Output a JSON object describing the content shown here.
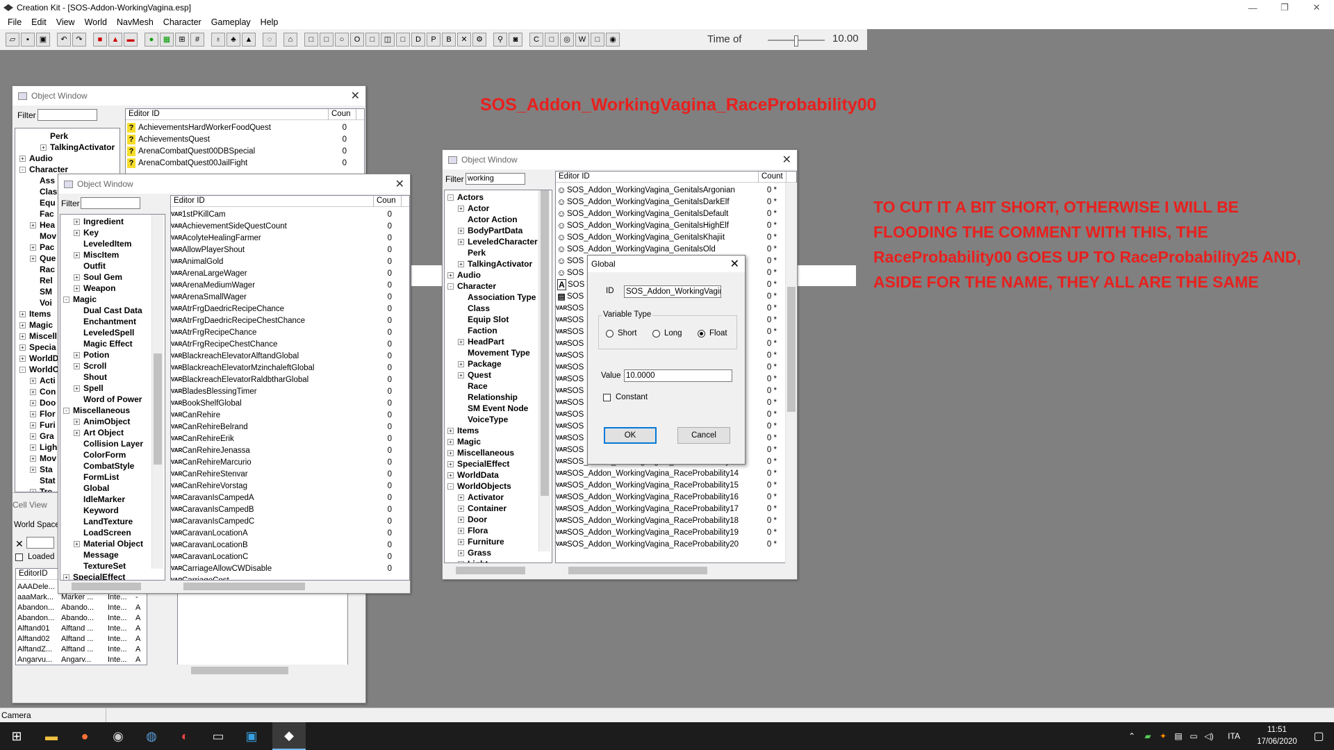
{
  "app": {
    "title": "Creation Kit - [SOS-Addon-WorkingVagina.esp]",
    "window_controls": [
      "—",
      "❐",
      "✕"
    ]
  },
  "menu": [
    "File",
    "Edit",
    "View",
    "World",
    "NavMesh",
    "Character",
    "Gameplay",
    "Help"
  ],
  "toolbar": {
    "time_label": "Time of",
    "time_value": "10.00"
  },
  "annotations": {
    "title": "SOS_Addon_WorkingVagina_RaceProbability00",
    "body": "TO CUT IT A BIT SHORT, OTHERWISE I WILL BE FLOODING THE COMMENT WITH THIS, THE RaceProbability00  GOES UP TO RaceProbability25  AND, ASIDE FOR THE NAME, THEY ALL ARE THE SAME"
  },
  "window1": {
    "title": "Object Window",
    "filter_label": "Filter",
    "filter_value": "",
    "col_editor_id": "Editor ID",
    "col_count": "Coun",
    "tree": [
      {
        "label": "Perk",
        "level": 2,
        "exp": ""
      },
      {
        "label": "TalkingActivator",
        "level": 2,
        "exp": "+"
      },
      {
        "label": "Audio",
        "level": 0,
        "exp": "+"
      },
      {
        "label": "Character",
        "level": 0,
        "exp": "-"
      },
      {
        "label": "Ass",
        "level": 1,
        "exp": ""
      },
      {
        "label": "Clas",
        "level": 1,
        "exp": ""
      },
      {
        "label": "Equ",
        "level": 1,
        "exp": ""
      },
      {
        "label": "Fac",
        "level": 1,
        "exp": ""
      },
      {
        "label": "Hea",
        "level": 1,
        "exp": "+"
      },
      {
        "label": "Mov",
        "level": 1,
        "exp": ""
      },
      {
        "label": "Pac",
        "level": 1,
        "exp": "+"
      },
      {
        "label": "Que",
        "level": 1,
        "exp": "+"
      },
      {
        "label": "Rac",
        "level": 1,
        "exp": ""
      },
      {
        "label": "Rel",
        "level": 1,
        "exp": ""
      },
      {
        "label": "SM",
        "level": 1,
        "exp": ""
      },
      {
        "label": "Voi",
        "level": 1,
        "exp": ""
      },
      {
        "label": "Items",
        "level": 0,
        "exp": "+"
      },
      {
        "label": "Magic",
        "level": 0,
        "exp": "+"
      },
      {
        "label": "Miscell",
        "level": 0,
        "exp": "+"
      },
      {
        "label": "Specia",
        "level": 0,
        "exp": "+"
      },
      {
        "label": "WorldD",
        "level": 0,
        "exp": "+"
      },
      {
        "label": "WorldO",
        "level": 0,
        "exp": "-"
      },
      {
        "label": "Acti",
        "level": 1,
        "exp": "+"
      },
      {
        "label": "Con",
        "level": 1,
        "exp": "+"
      },
      {
        "label": "Doo",
        "level": 1,
        "exp": "+"
      },
      {
        "label": "Flor",
        "level": 1,
        "exp": "+"
      },
      {
        "label": "Furi",
        "level": 1,
        "exp": "+"
      },
      {
        "label": "Gra",
        "level": 1,
        "exp": "+"
      },
      {
        "label": "Ligh",
        "level": 1,
        "exp": "+"
      },
      {
        "label": "Mov",
        "level": 1,
        "exp": "+"
      },
      {
        "label": "Sta",
        "level": 1,
        "exp": "+"
      },
      {
        "label": "Stat",
        "level": 1,
        "exp": ""
      },
      {
        "label": "Tre",
        "level": 1,
        "exp": "+"
      }
    ],
    "rows": [
      {
        "name": "AchievementsHardWorkerFoodQuest",
        "count": "0"
      },
      {
        "name": "AchievementsQuest",
        "count": "0"
      },
      {
        "name": "ArenaCombatQuest00DBSpecial",
        "count": "0"
      },
      {
        "name": "ArenaCombatQuest00JailFight",
        "count": "0"
      }
    ]
  },
  "cellview": {
    "title": "Cell View",
    "world_space_label": "World Space",
    "loaded_label": "Loaded",
    "col_editor_id": "EditorID",
    "rows": [
      [
        "AAADele...",
        "",
        "Inte...",
        "-"
      ],
      [
        "aaaMark...",
        "Marker ...",
        "Inte...",
        "-"
      ],
      [
        "Abandon...",
        "Abando...",
        "Inte...",
        "A"
      ],
      [
        "Abandon...",
        "Abando...",
        "Inte...",
        "A"
      ],
      [
        "Alftand01",
        "Alftand ...",
        "Inte...",
        "A"
      ],
      [
        "Alftand02",
        "Alftand ...",
        "Inte...",
        "A"
      ],
      [
        "AlftandZ...",
        "Alftand ...",
        "Inte...",
        "A"
      ],
      [
        "Angarvu...",
        "Angarv...",
        "Inte...",
        "A"
      ]
    ]
  },
  "window2": {
    "title": "Object Window",
    "filter_label": "Filter",
    "filter_value": "",
    "col_editor_id": "Editor ID",
    "col_count": "Coun",
    "tree": [
      {
        "label": "Ingredient",
        "level": 1,
        "exp": "+"
      },
      {
        "label": "Key",
        "level": 1,
        "exp": "+"
      },
      {
        "label": "LeveledItem",
        "level": 1,
        "exp": ""
      },
      {
        "label": "MiscItem",
        "level": 1,
        "exp": "+"
      },
      {
        "label": "Outfit",
        "level": 1,
        "exp": ""
      },
      {
        "label": "Soul Gem",
        "level": 1,
        "exp": "+"
      },
      {
        "label": "Weapon",
        "level": 1,
        "exp": "+"
      },
      {
        "label": "Magic",
        "level": 0,
        "exp": "-"
      },
      {
        "label": "Dual Cast Data",
        "level": 1,
        "exp": ""
      },
      {
        "label": "Enchantment",
        "level": 1,
        "exp": ""
      },
      {
        "label": "LeveledSpell",
        "level": 1,
        "exp": ""
      },
      {
        "label": "Magic Effect",
        "level": 1,
        "exp": ""
      },
      {
        "label": "Potion",
        "level": 1,
        "exp": "+"
      },
      {
        "label": "Scroll",
        "level": 1,
        "exp": "+"
      },
      {
        "label": "Shout",
        "level": 1,
        "exp": ""
      },
      {
        "label": "Spell",
        "level": 1,
        "exp": "+"
      },
      {
        "label": "Word of Power",
        "level": 1,
        "exp": ""
      },
      {
        "label": "Miscellaneous",
        "level": 0,
        "exp": "-"
      },
      {
        "label": "AnimObject",
        "level": 1,
        "exp": "+"
      },
      {
        "label": "Art Object",
        "level": 1,
        "exp": "+"
      },
      {
        "label": "Collision Layer",
        "level": 1,
        "exp": ""
      },
      {
        "label": "ColorForm",
        "level": 1,
        "exp": ""
      },
      {
        "label": "CombatStyle",
        "level": 1,
        "exp": ""
      },
      {
        "label": "FormList",
        "level": 1,
        "exp": ""
      },
      {
        "label": "Global",
        "level": 1,
        "exp": ""
      },
      {
        "label": "IdleMarker",
        "level": 1,
        "exp": ""
      },
      {
        "label": "Keyword",
        "level": 1,
        "exp": ""
      },
      {
        "label": "LandTexture",
        "level": 1,
        "exp": ""
      },
      {
        "label": "LoadScreen",
        "level": 1,
        "exp": ""
      },
      {
        "label": "Material Object",
        "level": 1,
        "exp": "+"
      },
      {
        "label": "Message",
        "level": 1,
        "exp": ""
      },
      {
        "label": "TextureSet",
        "level": 1,
        "exp": ""
      },
      {
        "label": "SpecialEffect",
        "level": 0,
        "exp": "+"
      }
    ],
    "rows": [
      {
        "name": "1stPKillCam",
        "count": "0"
      },
      {
        "name": "AchievementSideQuestCount",
        "count": "0"
      },
      {
        "name": "AcolyteHealingFarmer",
        "count": "0"
      },
      {
        "name": "AllowPlayerShout",
        "count": "0"
      },
      {
        "name": "AnimalGold",
        "count": "0"
      },
      {
        "name": "ArenaLargeWager",
        "count": "0"
      },
      {
        "name": "ArenaMediumWager",
        "count": "0"
      },
      {
        "name": "ArenaSmallWager",
        "count": "0"
      },
      {
        "name": "AtrFrgDaedricRecipeChance",
        "count": "0"
      },
      {
        "name": "AtrFrgDaedricRecipeChestChance",
        "count": "0"
      },
      {
        "name": "AtrFrgRecipeChance",
        "count": "0"
      },
      {
        "name": "AtrFrgRecipeChestChance",
        "count": "0"
      },
      {
        "name": "BlackreachElevatorAlftandGlobal",
        "count": "0"
      },
      {
        "name": "BlackreachElevatorMzinchaleftGlobal",
        "count": "0"
      },
      {
        "name": "BlackreachElevatorRaldbtharGlobal",
        "count": "0"
      },
      {
        "name": "BladesBlessingTimer",
        "count": "0"
      },
      {
        "name": "BookShelfGlobal",
        "count": "0"
      },
      {
        "name": "CanRehire",
        "count": "0"
      },
      {
        "name": "CanRehireBelrand",
        "count": "0"
      },
      {
        "name": "CanRehireErik",
        "count": "0"
      },
      {
        "name": "CanRehireJenassa",
        "count": "0"
      },
      {
        "name": "CanRehireMarcurio",
        "count": "0"
      },
      {
        "name": "CanRehireStenvar",
        "count": "0"
      },
      {
        "name": "CanRehireVorstag",
        "count": "0"
      },
      {
        "name": "CaravanIsCampedA",
        "count": "0"
      },
      {
        "name": "CaravanIsCampedB",
        "count": "0"
      },
      {
        "name": "CaravanIsCampedC",
        "count": "0"
      },
      {
        "name": "CaravanLocationA",
        "count": "0"
      },
      {
        "name": "CaravanLocationB",
        "count": "0"
      },
      {
        "name": "CaravanLocationC",
        "count": "0"
      },
      {
        "name": "CarriageAllowCWDisable",
        "count": "0"
      },
      {
        "name": "CarriageCost",
        "count": ""
      }
    ]
  },
  "window3": {
    "title": "Object Window",
    "filter_label": "Filter",
    "filter_value": "working",
    "col_editor_id": "Editor ID",
    "col_count": "Count",
    "tree": [
      {
        "label": "Actors",
        "level": 0,
        "exp": "-"
      },
      {
        "label": "Actor",
        "level": 1,
        "exp": "+"
      },
      {
        "label": "Actor Action",
        "level": 1,
        "exp": ""
      },
      {
        "label": "BodyPartData",
        "level": 1,
        "exp": "+"
      },
      {
        "label": "LeveledCharacter",
        "level": 1,
        "exp": "+"
      },
      {
        "label": "Perk",
        "level": 1,
        "exp": ""
      },
      {
        "label": "TalkingActivator",
        "level": 1,
        "exp": "+"
      },
      {
        "label": "Audio",
        "level": 0,
        "exp": "+"
      },
      {
        "label": "Character",
        "level": 0,
        "exp": "-"
      },
      {
        "label": "Association Type",
        "level": 1,
        "exp": ""
      },
      {
        "label": "Class",
        "level": 1,
        "exp": ""
      },
      {
        "label": "Equip Slot",
        "level": 1,
        "exp": ""
      },
      {
        "label": "Faction",
        "level": 1,
        "exp": ""
      },
      {
        "label": "HeadPart",
        "level": 1,
        "exp": "+"
      },
      {
        "label": "Movement Type",
        "level": 1,
        "exp": ""
      },
      {
        "label": "Package",
        "level": 1,
        "exp": "+"
      },
      {
        "label": "Quest",
        "level": 1,
        "exp": "+"
      },
      {
        "label": "Race",
        "level": 1,
        "exp": ""
      },
      {
        "label": "Relationship",
        "level": 1,
        "exp": ""
      },
      {
        "label": "SM Event Node",
        "level": 1,
        "exp": ""
      },
      {
        "label": "VoiceType",
        "level": 1,
        "exp": ""
      },
      {
        "label": "Items",
        "level": 0,
        "exp": "+"
      },
      {
        "label": "Magic",
        "level": 0,
        "exp": "+"
      },
      {
        "label": "Miscellaneous",
        "level": 0,
        "exp": "+"
      },
      {
        "label": "SpecialEffect",
        "level": 0,
        "exp": "+"
      },
      {
        "label": "WorldData",
        "level": 0,
        "exp": "+"
      },
      {
        "label": "WorldObjects",
        "level": 0,
        "exp": "-"
      },
      {
        "label": "Activator",
        "level": 1,
        "exp": "+"
      },
      {
        "label": "Container",
        "level": 1,
        "exp": "+"
      },
      {
        "label": "Door",
        "level": 1,
        "exp": "+"
      },
      {
        "label": "Flora",
        "level": 1,
        "exp": "+"
      },
      {
        "label": "Furniture",
        "level": 1,
        "exp": "+"
      },
      {
        "label": "Grass",
        "level": 1,
        "exp": "+"
      },
      {
        "label": "Light",
        "level": 1,
        "exp": "+"
      }
    ],
    "rows": [
      {
        "icon": "npc",
        "name": "SOS_Addon_WorkingVagina_GenitalsArgonian",
        "count": "0 *"
      },
      {
        "icon": "npc",
        "name": "SOS_Addon_WorkingVagina_GenitalsDarkElf",
        "count": "0 *"
      },
      {
        "icon": "npc",
        "name": "SOS_Addon_WorkingVagina_GenitalsDefault",
        "count": "0 *"
      },
      {
        "icon": "npc",
        "name": "SOS_Addon_WorkingVagina_GenitalsHighElf",
        "count": "0 *"
      },
      {
        "icon": "npc",
        "name": "SOS_Addon_WorkingVagina_GenitalsKhajiit",
        "count": "0 *"
      },
      {
        "icon": "npc",
        "name": "SOS_Addon_WorkingVagina_GenitalsOld",
        "count": "0 *"
      },
      {
        "icon": "npc",
        "name": "SOS",
        "count": "0 *"
      },
      {
        "icon": "npc",
        "name": "SOS",
        "count": "0 *"
      },
      {
        "icon": "armor",
        "name": "SOS",
        "count": "0 *"
      },
      {
        "icon": "book",
        "name": "SOS",
        "count": "0 *"
      },
      {
        "icon": "var",
        "name": "SOS",
        "count": "0 *"
      },
      {
        "icon": "var",
        "name": "SOS",
        "count": "0 *"
      },
      {
        "icon": "var",
        "name": "SOS",
        "count": "0 *"
      },
      {
        "icon": "var",
        "name": "SOS",
        "count": "0 *"
      },
      {
        "icon": "var",
        "name": "SOS",
        "count": "0 *"
      },
      {
        "icon": "var",
        "name": "SOS",
        "count": "0 *"
      },
      {
        "icon": "var",
        "name": "SOS",
        "count": "0 *"
      },
      {
        "icon": "var",
        "name": "SOS",
        "count": "0 *"
      },
      {
        "icon": "var",
        "name": "SOS",
        "count": "0 *"
      },
      {
        "icon": "var",
        "name": "SOS",
        "count": "0 *"
      },
      {
        "icon": "var",
        "name": "SOS",
        "count": "0 *"
      },
      {
        "icon": "var",
        "name": "SOS",
        "count": "0 *"
      },
      {
        "icon": "var",
        "name": "SOS",
        "count": "0 *"
      },
      {
        "icon": "var",
        "name": "SOS_Addon_WorkingVagina_RaceProbability13",
        "count": "0 *"
      },
      {
        "icon": "var",
        "name": "SOS_Addon_WorkingVagina_RaceProbability14",
        "count": "0 *"
      },
      {
        "icon": "var",
        "name": "SOS_Addon_WorkingVagina_RaceProbability15",
        "count": "0 *"
      },
      {
        "icon": "var",
        "name": "SOS_Addon_WorkingVagina_RaceProbability16",
        "count": "0 *"
      },
      {
        "icon": "var",
        "name": "SOS_Addon_WorkingVagina_RaceProbability17",
        "count": "0 *"
      },
      {
        "icon": "var",
        "name": "SOS_Addon_WorkingVagina_RaceProbability18",
        "count": "0 *"
      },
      {
        "icon": "var",
        "name": "SOS_Addon_WorkingVagina_RaceProbability19",
        "count": "0 *"
      },
      {
        "icon": "var",
        "name": "SOS_Addon_WorkingVagina_RaceProbability20",
        "count": "0 *"
      }
    ]
  },
  "global_dialog": {
    "title": "Global",
    "id_label": "ID",
    "id_value": "SOS_Addon_WorkingVagina",
    "variable_type_label": "Variable Type",
    "types": [
      "Short",
      "Long",
      "Float"
    ],
    "selected_type": "Float",
    "value_label": "Value",
    "value": "10.0000",
    "constant_label": "Constant",
    "ok_label": "OK",
    "cancel_label": "Cancel"
  },
  "statusbar": {
    "text": "Camera"
  },
  "taskbar": {
    "language": "ITA",
    "time": "11:51",
    "date": "17/06/2020"
  },
  "colors": {
    "annotation": "#e8201e",
    "taskbar": "#1c1c1c",
    "workspace": "#808080"
  }
}
